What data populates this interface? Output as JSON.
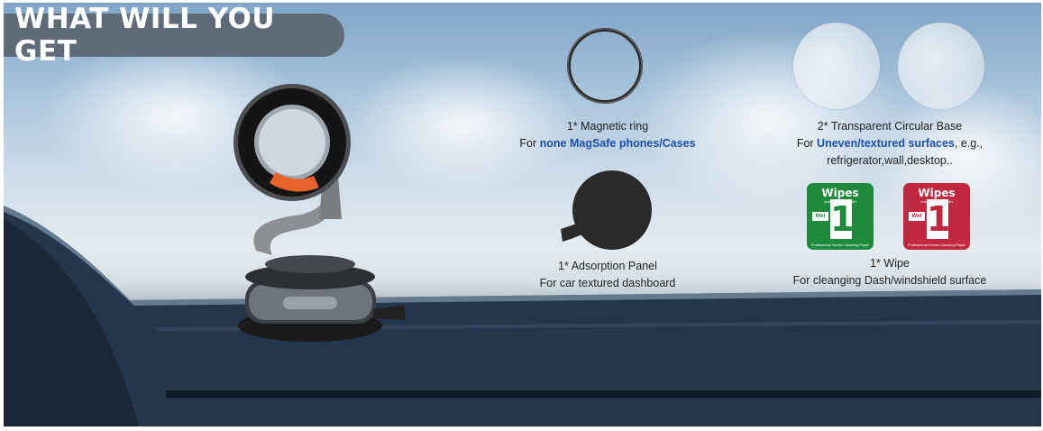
{
  "banner": {
    "title": "WHAT WILL YOU GET"
  },
  "items": {
    "ring": {
      "line1": "1* Magnetic ring",
      "line2_prefix": "For ",
      "line2_highlight": "none MagSafe phones/Cases"
    },
    "base": {
      "line1": "2* Transparent Circular Base",
      "line2_prefix": "For ",
      "line2_highlight": "Uneven/textured surfaces",
      "line2_suffix": ", e.g.,",
      "line3": "refrigerator,wall,desktop.."
    },
    "panel": {
      "line1": "1* Adsorption Panel",
      "line2": "For car textured dashboard"
    },
    "wipe": {
      "line1": "1* Wipe",
      "line2": "For cleanging Dash/windshield surface"
    }
  },
  "wipes": [
    {
      "title": "Wipes",
      "sub": "removes excess dirt",
      "wet": "Wet",
      "num": "1",
      "foot": "Professional Screen Cleaning Paper",
      "color": "#1f8a3c"
    },
    {
      "title": "Wipes",
      "sub": "removes excess dirt",
      "wet": "Wet",
      "num": "1",
      "foot": "Professional Screen Cleaning Paper",
      "color": "#c0283f"
    }
  ],
  "colors": {
    "highlight": "#1f4fae",
    "banner": "#5f6b78",
    "accent_orange": "#e8632a"
  }
}
